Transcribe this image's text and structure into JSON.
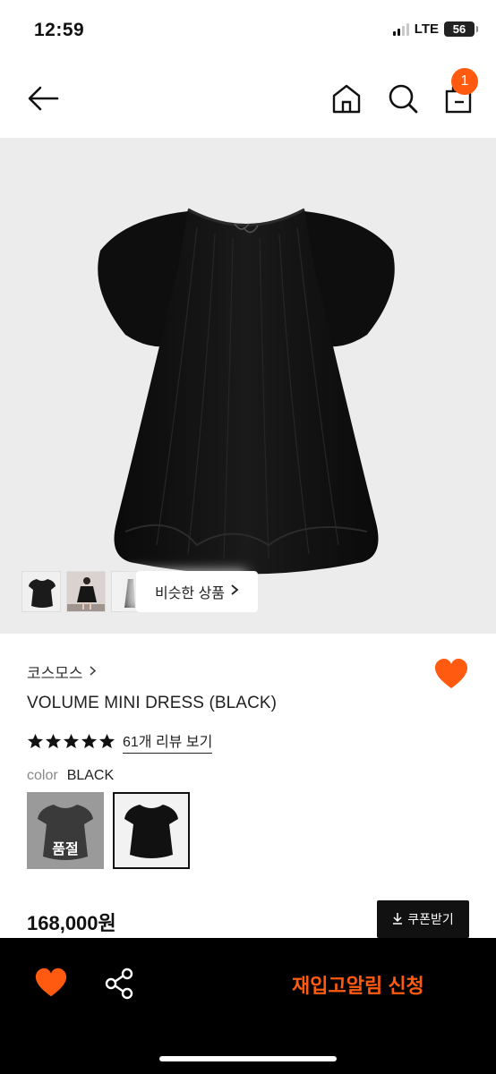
{
  "status_bar": {
    "time": "12:59",
    "network": "LTE",
    "battery": "56"
  },
  "header": {
    "back_icon": "arrow-left-icon",
    "home_icon": "home-icon",
    "search_icon": "search-icon",
    "cart_icon": "shopping-bag-icon",
    "cart_count": "1"
  },
  "gallery": {
    "similar_products_label": "비슷한 상품",
    "similar_chevron": "›"
  },
  "product": {
    "brand": "코스모스",
    "brand_chevron": "›",
    "name": "VOLUME MINI DRESS (BLACK)",
    "rating_stars": 5,
    "review_link": "61개 리뷰 보기",
    "color_label": "color",
    "color_value": "BLACK",
    "swatches": [
      {
        "state": "sold out",
        "label": "품절"
      },
      {
        "state": "selected",
        "label": ""
      }
    ],
    "price": "168,000원",
    "coupon_label": "쿠폰받기"
  },
  "bottom_bar": {
    "wishlist_icon": "heart-icon",
    "share_icon": "share-icon",
    "restock_label": "재입고알림 신청"
  },
  "colors": {
    "accent": "#ff5a10",
    "black": "#000000",
    "hero_bg": "#ececec"
  }
}
